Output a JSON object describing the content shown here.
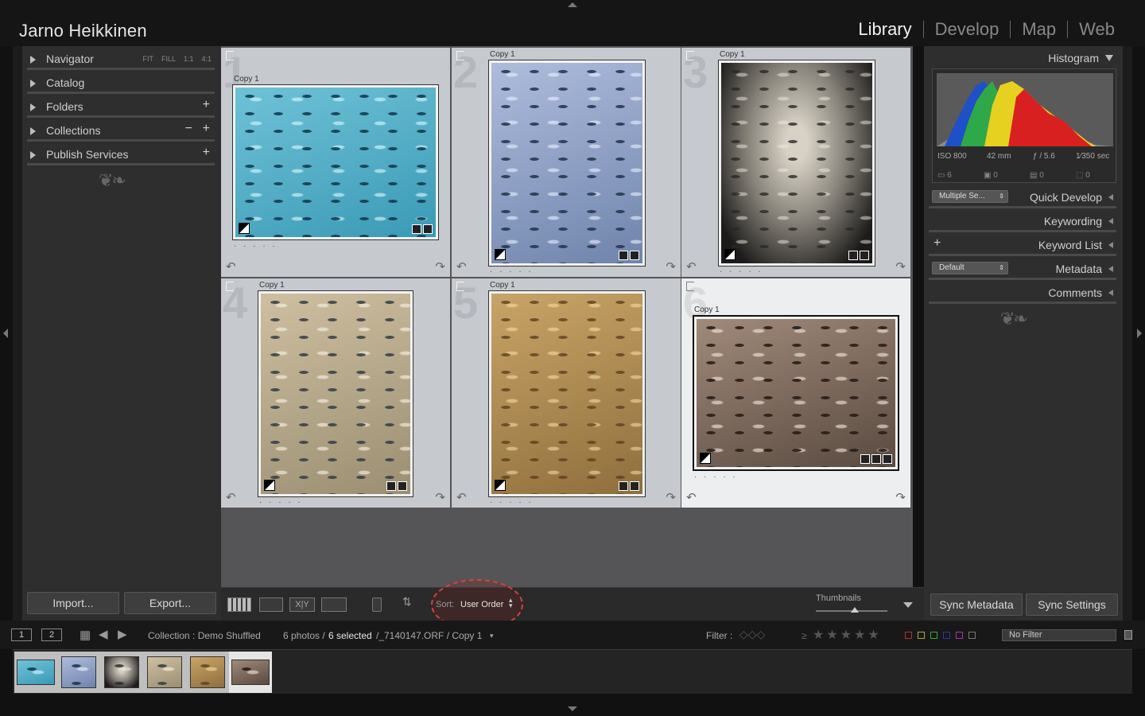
{
  "identity": "Jarno Heikkinen",
  "modules": [
    {
      "label": "Library",
      "active": true
    },
    {
      "label": "Develop",
      "active": false
    },
    {
      "label": "Map",
      "active": false
    },
    {
      "label": "Web",
      "active": false
    }
  ],
  "left_panel": {
    "navigator": {
      "label": "Navigator",
      "options": [
        "FIT",
        "FILL",
        "1:1",
        "4:1"
      ]
    },
    "catalog": "Catalog",
    "folders": "Folders",
    "collections": "Collections",
    "publish_services": "Publish Services",
    "import_label": "Import...",
    "export_label": "Export..."
  },
  "grid": {
    "cells": [
      {
        "number": "1",
        "copy": "Copy 1",
        "tone": "tx1",
        "orientation": "landscape",
        "selected": false
      },
      {
        "number": "2",
        "copy": "Copy 1",
        "tone": "tx2",
        "orientation": "portrait",
        "selected": false
      },
      {
        "number": "3",
        "copy": "Copy 1",
        "tone": "tx3",
        "orientation": "portrait",
        "selected": false
      },
      {
        "number": "4",
        "copy": "Copy 1",
        "tone": "tx4",
        "orientation": "portrait",
        "selected": false
      },
      {
        "number": "5",
        "copy": "Copy 1",
        "tone": "tx5",
        "orientation": "portrait",
        "selected": false
      },
      {
        "number": "6",
        "copy": "Copy 1",
        "tone": "tx6",
        "orientation": "landscape",
        "selected": true
      }
    ],
    "stars_placeholder": "· · · · ·"
  },
  "toolbar": {
    "sort_label": "Sort:",
    "sort_value": "User Order",
    "thumbnails_label": "Thumbnails"
  },
  "right_panel": {
    "histogram": {
      "title": "Histogram",
      "iso": "ISO 800",
      "focal": "42 mm",
      "aperture": "ƒ / 5.6",
      "shutter": "1⁄350 sec",
      "counts": [
        "6",
        "0",
        "0",
        "0"
      ]
    },
    "quick_develop": {
      "label": "Quick Develop",
      "preset": "Multiple Se..."
    },
    "keywording": "Keywording",
    "keyword_list": "Keyword List",
    "metadata": {
      "label": "Metadata",
      "preset": "Default"
    },
    "comments": "Comments",
    "sync_metadata_label": "Sync Metadata",
    "sync_settings_label": "Sync Settings"
  },
  "filmstrip_header": {
    "window_1": "1",
    "window_2": "2",
    "collection": "Collection : Demo Shuffled",
    "photos_count": "6 photos /",
    "selected_count": "6 selected",
    "file": "/_7140147.ORF / Copy 1",
    "filter_label": "Filter :",
    "no_filter": "No Filter"
  },
  "filmstrip": {
    "thumbs": [
      "tx1",
      "tx2",
      "tx3",
      "tx4",
      "tx5",
      "tx6"
    ]
  },
  "colors": {
    "accent_highlight": "#d5433c",
    "panel_bg": "#2e2e2e",
    "grid_bg": "#555557"
  }
}
